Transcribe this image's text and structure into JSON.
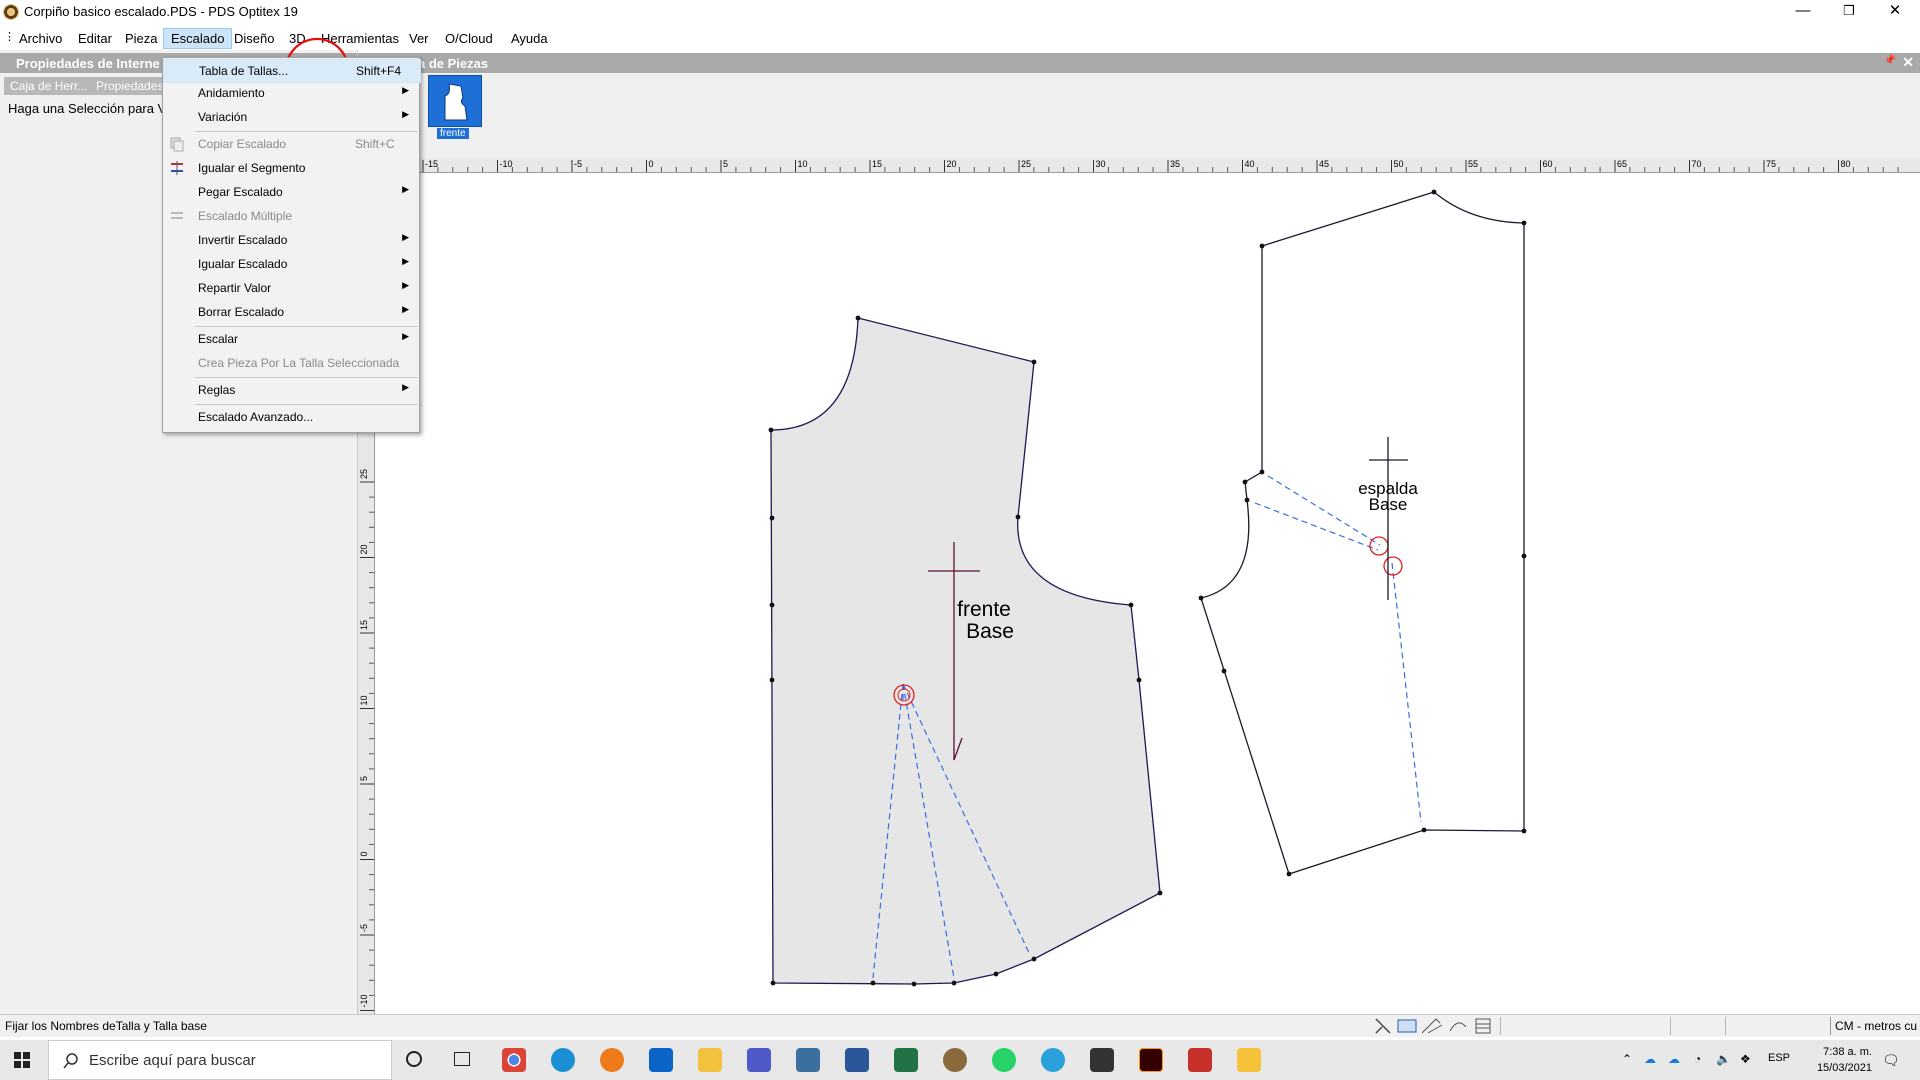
{
  "window": {
    "title": "Corpiño basico escalado.PDS - PDS Optitex 19",
    "minimize": "—",
    "maximize": "❐",
    "close": "✕"
  },
  "menubar": {
    "items": [
      "Archivo",
      "Editar",
      "Pieza",
      "Escalado",
      "Diseño",
      "3D",
      "Herramientas",
      "Ver",
      "O/Cloud",
      "Ayuda"
    ],
    "active": "Escalado"
  },
  "left_panel": {
    "header": "Propiedades de Interne",
    "tabs": [
      "Caja de Herr...",
      "Propiedades"
    ],
    "message": "Haga una Selección para Ve"
  },
  "pieces_panel": {
    "header": "a de Piezas",
    "pin": "📌",
    "close": "✕",
    "thumb_label": "frente"
  },
  "escalado_menu": {
    "items": [
      {
        "label": "Tabla de Tallas...",
        "shortcut": "Shift+F4",
        "submenu": false,
        "disabled": false
      },
      {
        "label": "Anidamiento",
        "shortcut": "",
        "submenu": true,
        "disabled": false
      },
      {
        "label": "Variación",
        "shortcut": "",
        "submenu": true,
        "disabled": false
      },
      {
        "label": "Copiar Escalado",
        "shortcut": "Shift+C",
        "submenu": false,
        "disabled": true
      },
      {
        "label": "Igualar el Segmento",
        "shortcut": "",
        "submenu": false,
        "disabled": false
      },
      {
        "label": "Pegar Escalado",
        "shortcut": "",
        "submenu": true,
        "disabled": false
      },
      {
        "label": "Escalado Múltiple",
        "shortcut": "",
        "submenu": false,
        "disabled": true
      },
      {
        "label": "Invertir Escalado",
        "shortcut": "",
        "submenu": true,
        "disabled": false
      },
      {
        "label": "Igualar Escalado",
        "shortcut": "",
        "submenu": true,
        "disabled": false
      },
      {
        "label": "Repartir Valor",
        "shortcut": "",
        "submenu": true,
        "disabled": false
      },
      {
        "label": "Borrar Escalado",
        "shortcut": "",
        "submenu": true,
        "disabled": false
      },
      {
        "label": "Escalar",
        "shortcut": "",
        "submenu": true,
        "disabled": false
      },
      {
        "label": "Crea Pieza Por La Talla Seleccionada",
        "shortcut": "",
        "submenu": false,
        "disabled": true
      },
      {
        "label": "Reglas",
        "shortcut": "",
        "submenu": true,
        "disabled": false
      },
      {
        "label": "Escalado Avanzado...",
        "shortcut": "",
        "submenu": false,
        "disabled": false
      }
    ]
  },
  "rulers": {
    "horizontal_ticks": [
      "-15",
      "-10",
      "-5",
      "0",
      "5",
      "10",
      "15",
      "20",
      "25",
      "30",
      "35",
      "40",
      "45",
      "50",
      "55",
      "60",
      "65",
      "70",
      "75",
      "80"
    ],
    "vertical_ticks": [
      "25",
      "20",
      "15",
      "10",
      "5",
      "0",
      "-5",
      "-10"
    ]
  },
  "pieces": {
    "front": {
      "name": "frente",
      "size": "Base"
    },
    "back": {
      "name": "espalda",
      "size": "Base"
    }
  },
  "statusbar": {
    "message": "Fijar los Nombres deTalla y Talla base",
    "units": "CM - metros cu"
  },
  "taskbar": {
    "search_placeholder": "Escribe aquí para buscar",
    "language": "ESP",
    "time": "7:38 a. m.",
    "date": "15/03/2021"
  }
}
